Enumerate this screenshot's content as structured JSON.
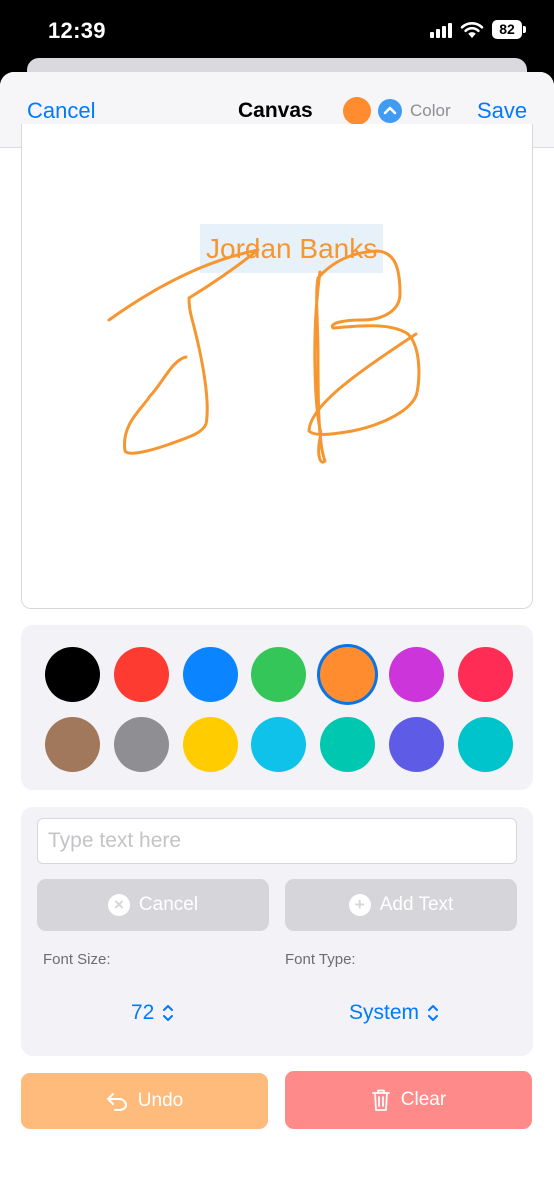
{
  "status": {
    "time": "12:39",
    "battery": "82"
  },
  "nav": {
    "cancel": "Cancel",
    "title": "Canvas",
    "color_label": "Color",
    "save": "Save"
  },
  "canvas": {
    "text": "Jordan Banks",
    "stroke_color": "#f59630"
  },
  "palette": {
    "rows": [
      [
        "#000000",
        "#fe3b30",
        "#0a84ff",
        "#34c659",
        "#ff8c2e",
        "#cc35d9",
        "#ff2d55"
      ],
      [
        "#a2785c",
        "#8e8e93",
        "#ffcc00",
        "#0fc2ea",
        "#00c7b0",
        "#5e5ce6",
        "#00c4cc"
      ]
    ],
    "selected": "#ff8c2e"
  },
  "text_panel": {
    "input_placeholder": "Type text here",
    "cancel_label": "Cancel",
    "add_text_label": "Add Text",
    "font_size_label": "Font Size:",
    "font_size_value": "72",
    "font_type_label": "Font Type:",
    "font_type_value": "System"
  },
  "actions": {
    "undo": "Undo",
    "clear": "Clear"
  }
}
